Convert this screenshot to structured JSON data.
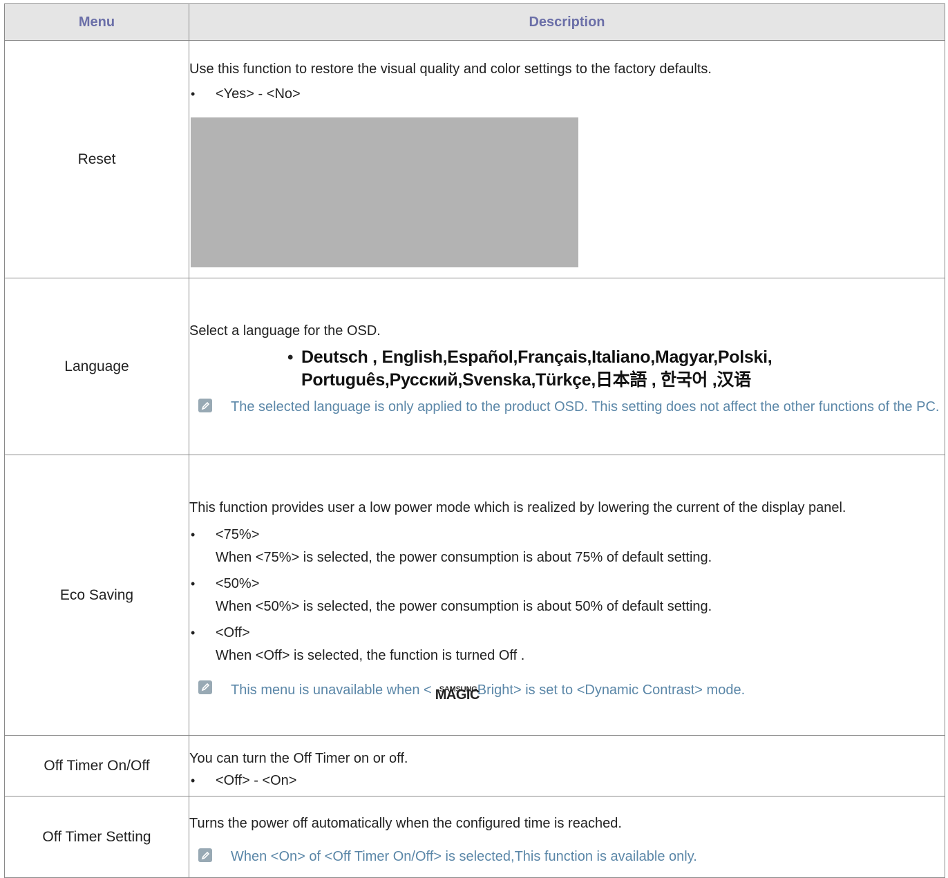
{
  "header": {
    "menu": "Menu",
    "description": "Description"
  },
  "reset": {
    "menu": "Reset",
    "text": "Use this function to restore the visual quality and color settings to the factory defaults.",
    "options": "<Yes> - <No>"
  },
  "language": {
    "menu": "Language",
    "text": "Select a language for the OSD.",
    "line1": "Deutsch , English,Español,Français,Italiano,Magyar,Polski,",
    "line2": "Português,Русский,Svenska,Türkçe,日本語 , 한국어 ,汉语",
    "note": "The selected language is only applied to the product OSD. This setting does not affect the other functions of the PC."
  },
  "eco": {
    "menu": "Eco Saving",
    "text": "This function provides user a low power mode which is realized by lowering the current of the display panel.",
    "items": [
      {
        "label": "<75%>",
        "detail": "When <75%> is selected, the power consumption is about 75% of default setting."
      },
      {
        "label": "<50%>",
        "detail": "When <50%> is selected, the power consumption is about 50% of default setting."
      },
      {
        "label": "<Off>",
        "detail": "When <Off> is selected, the function is turned Off ."
      }
    ],
    "note_before": "This menu is unavailable when <",
    "logo_small": "SAMSUNG",
    "logo_big": "MAGIC",
    "note_after": "Bright> is set to <Dynamic Contrast> mode."
  },
  "off_timer": {
    "menu": "Off Timer On/Off",
    "text": "You can turn the Off Timer on or off.",
    "options": "<Off> - <On>"
  },
  "off_timer_setting": {
    "menu": "Off Timer Setting",
    "text": "Turns the power off automatically when the configured time is reached.",
    "note": "When <On> of <Off Timer On/Off> is selected,This function is available only."
  },
  "colors": {
    "header_text": "#6b6fa8",
    "note_text": "#5b87a8",
    "header_bg": "#e5e5e5"
  },
  "icons": {
    "note": "note-pencil-icon",
    "bullet": "bullet-dot"
  }
}
